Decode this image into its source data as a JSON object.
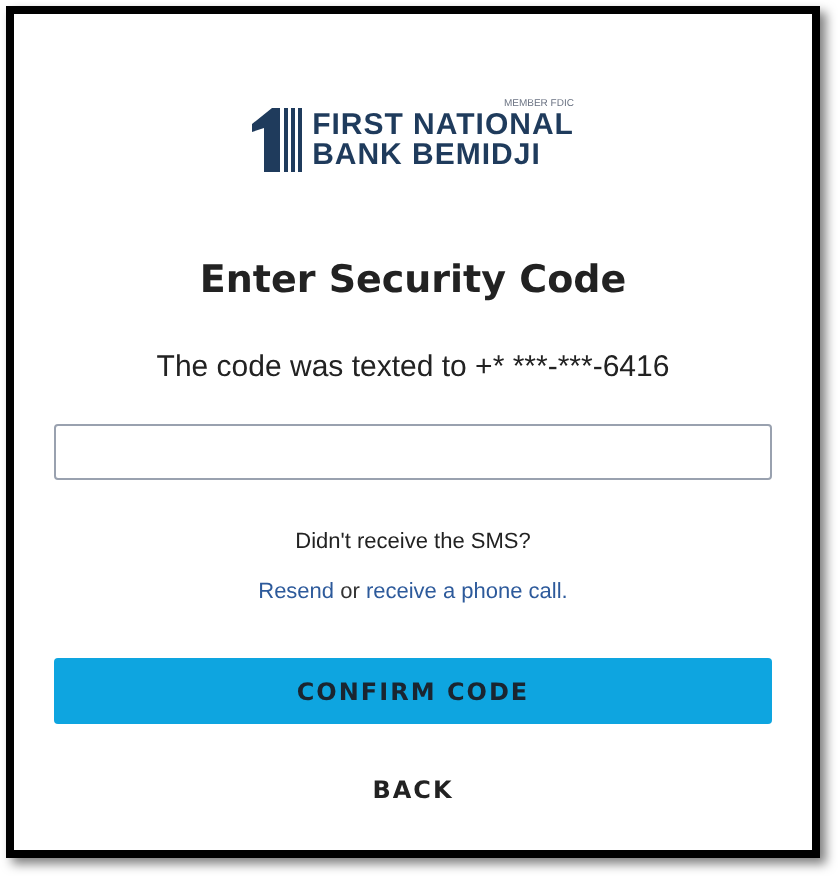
{
  "logo": {
    "badge": "MEMBER FDIC",
    "line_1": "FIRST NATIONAL",
    "line_2": "BANK BEMIDJI"
  },
  "title": "Enter Security Code",
  "message": "The code was texted to +* ***-***-6416",
  "help": {
    "question": "Didn't receive the SMS?",
    "resend_link": "Resend",
    "joiner": "or",
    "call_link": "receive a phone call."
  },
  "buttons": [
    {
      "label": "CONFIRM CODE",
      "kind": "primary"
    },
    {
      "label": "BACK",
      "kind": "text"
    }
  ]
}
